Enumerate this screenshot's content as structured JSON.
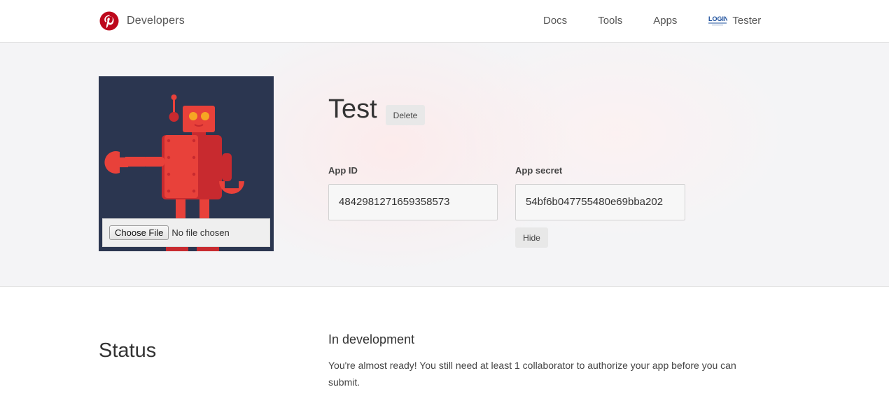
{
  "header": {
    "brand_name": "Developers",
    "brand_color": "#bd081c",
    "brand_icon": "pinterest-logo",
    "nav": {
      "docs": "Docs",
      "tools": "Tools",
      "apps": "Apps"
    },
    "user": {
      "name": "Tester",
      "avatar_icon": "login-avatar"
    }
  },
  "app": {
    "title": "Test",
    "delete_label": "Delete",
    "image": {
      "icon": "robot-illustration",
      "file_button": "Choose File",
      "file_status": "No file chosen"
    },
    "app_id_label": "App ID",
    "app_id_value": "4842981271659358573",
    "app_secret_label": "App secret",
    "app_secret_value": "54bf6b047755480e69bba202",
    "hide_label": "Hide"
  },
  "status": {
    "heading": "Status",
    "title": "In development",
    "description": "You're almost ready! You still need at least 1 collaborator to authorize your app before you can submit."
  },
  "colors": {
    "accent": "#bd081c",
    "hero_bg": "#f4f4f6",
    "robot_bg": "#2b3650",
    "robot_red": "#e8413a"
  }
}
